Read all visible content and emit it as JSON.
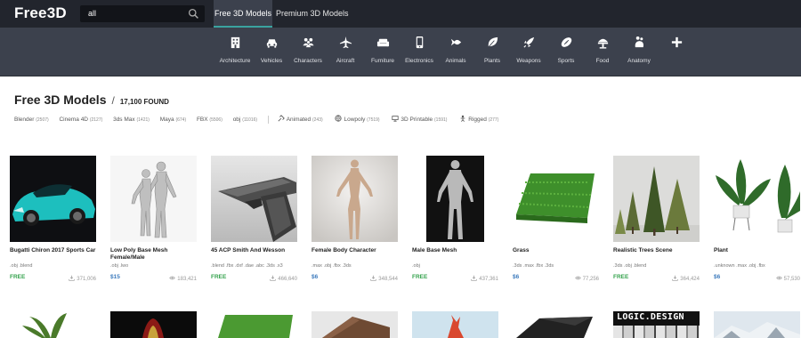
{
  "header": {
    "logo": "Free3D",
    "search_value": "all",
    "tabs": [
      {
        "label": "Free 3D Models",
        "active": true
      },
      {
        "label": "Premium 3D Models",
        "active": false
      }
    ]
  },
  "categories": [
    {
      "label": "Architecture",
      "icon": "building-icon"
    },
    {
      "label": "Vehicles",
      "icon": "car-icon"
    },
    {
      "label": "Characters",
      "icon": "people-icon"
    },
    {
      "label": "Aircraft",
      "icon": "plane-icon"
    },
    {
      "label": "Furniture",
      "icon": "sofa-icon"
    },
    {
      "label": "Electronics",
      "icon": "phone-icon"
    },
    {
      "label": "Animals",
      "icon": "fish-icon"
    },
    {
      "label": "Plants",
      "icon": "leaf-icon"
    },
    {
      "label": "Weapons",
      "icon": "rocket-icon"
    },
    {
      "label": "Sports",
      "icon": "football-icon"
    },
    {
      "label": "Food",
      "icon": "food-icon"
    },
    {
      "label": "Anatomy",
      "icon": "anatomy-icon"
    },
    {
      "label": "",
      "icon": "plus-icon"
    }
  ],
  "page": {
    "title": "Free 3D Models",
    "separator": "/",
    "count": "17,100 FOUND"
  },
  "filters": {
    "formats": [
      {
        "label": "Blender",
        "count": "(2507)"
      },
      {
        "label": "Cinema 4D",
        "count": "(2127)"
      },
      {
        "label": "3ds Max",
        "count": "(1421)"
      },
      {
        "label": "Maya",
        "count": "(674)"
      },
      {
        "label": "FBX",
        "count": "(5506)"
      },
      {
        "label": "obj",
        "count": "(11016)"
      }
    ],
    "features": [
      {
        "label": "Animated",
        "count": "(243)",
        "icon": "animated-icon"
      },
      {
        "label": "Lowpoly",
        "count": "(7519)",
        "icon": "lowpoly-icon"
      },
      {
        "label": "3D Printable",
        "count": "(1591)",
        "icon": "printer-icon"
      },
      {
        "label": "Rigged",
        "count": "(277)",
        "icon": "rigged-icon"
      }
    ]
  },
  "models": [
    {
      "title": "Bugatti Chiron 2017 Sports Car",
      "formats": ".obj .blend",
      "price": "FREE",
      "stat": "371,006",
      "stat_type": "download"
    },
    {
      "title": "Low Poly Base Mesh Female/Male",
      "formats": ".obj .lwo",
      "price": "$15",
      "stat": "183,421",
      "stat_type": "view"
    },
    {
      "title": "45 ACP Smith And Wesson",
      "formats": ".blend .fbx .dxf .dae .abc .3ds .x3",
      "price": "FREE",
      "stat": "466,640",
      "stat_type": "download"
    },
    {
      "title": "Female Body Character",
      "formats": ".max .obj .fbx .3ds",
      "price": "$6",
      "stat": "348,544",
      "stat_type": "download"
    },
    {
      "title": "Male Base Mesh",
      "formats": ".obj",
      "price": "FREE",
      "stat": "437,361",
      "stat_type": "download"
    },
    {
      "title": "Grass",
      "formats": ".3ds .max .fbx .3ds",
      "price": "$6",
      "stat": "77,256",
      "stat_type": "view"
    },
    {
      "title": "Realistic Trees Scene",
      "formats": ".3ds .obj .blend",
      "price": "FREE",
      "stat": "364,424",
      "stat_type": "download"
    },
    {
      "title": "Plant",
      "formats": ".unknown .max .obj .fbx",
      "price": "$6",
      "stat": "57,530",
      "stat_type": "view"
    }
  ],
  "second_row": [
    {
      "kind": "plant"
    },
    {
      "kind": "ironman"
    },
    {
      "kind": "grass"
    },
    {
      "kind": "house"
    },
    {
      "kind": "coral"
    },
    {
      "kind": "dark"
    },
    {
      "kind": "logic",
      "text": "LOGIC.DESIGN"
    },
    {
      "kind": "winter"
    }
  ]
}
